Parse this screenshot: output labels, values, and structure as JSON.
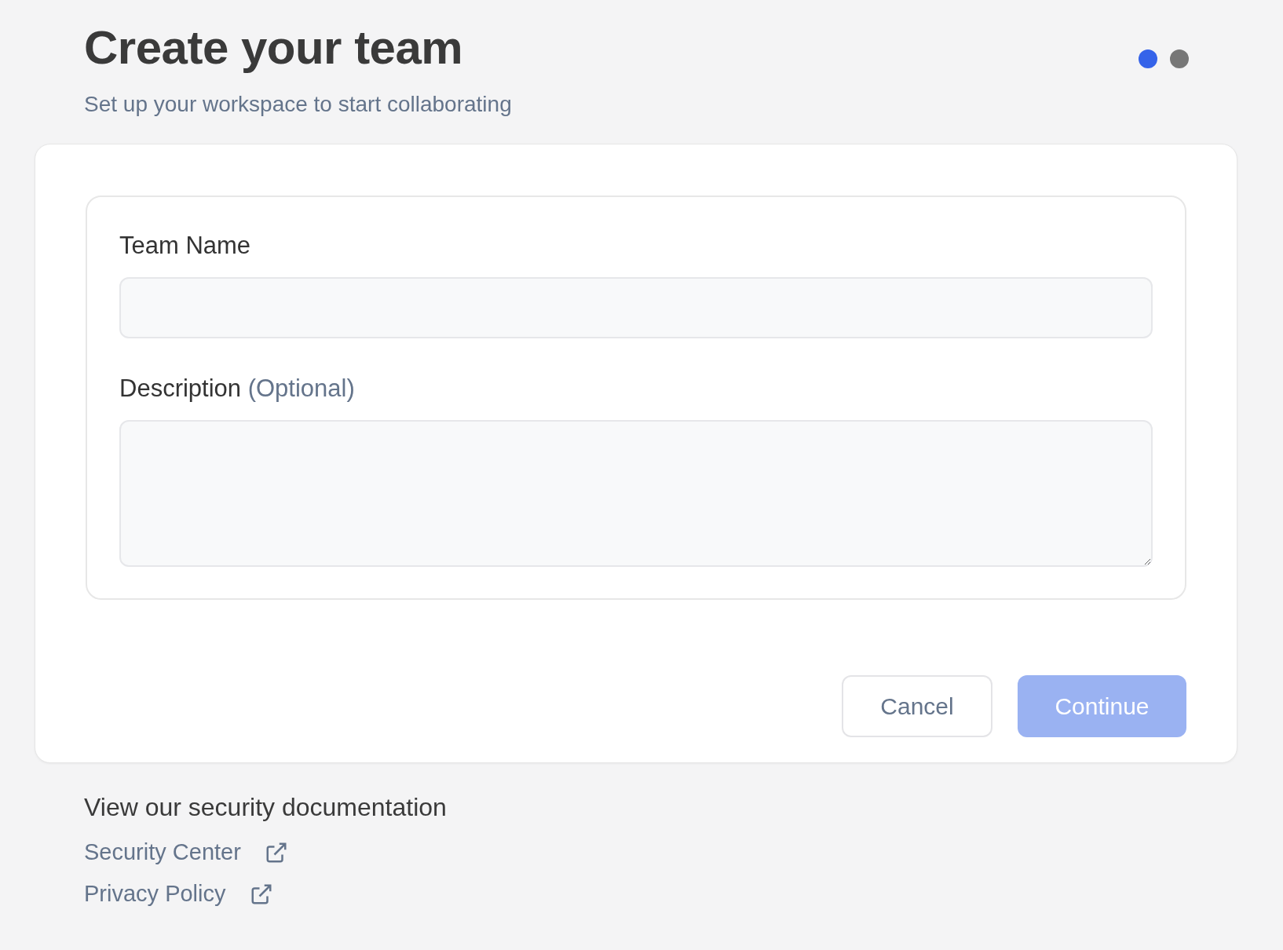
{
  "title": "Create your team",
  "subtitle": "Set up your workspace to start collaborating",
  "steps": [
    {
      "selected": true
    },
    {
      "selected": false
    }
  ],
  "fields": [
    {
      "kind": "input",
      "label": "Team Name"
    },
    {
      "kind": "textarea",
      "label": "Description",
      "hint": "(Optional)"
    }
  ],
  "buttons": [
    {
      "label": "Cancel",
      "kind": "secondary",
      "disabled": false
    },
    {
      "label": "Continue",
      "kind": "primary",
      "disabled": true
    }
  ],
  "footer": {
    "heading": "View our security documentation",
    "links": [
      {
        "label": "Security Center"
      },
      {
        "label": "Privacy Policy"
      }
    ]
  }
}
